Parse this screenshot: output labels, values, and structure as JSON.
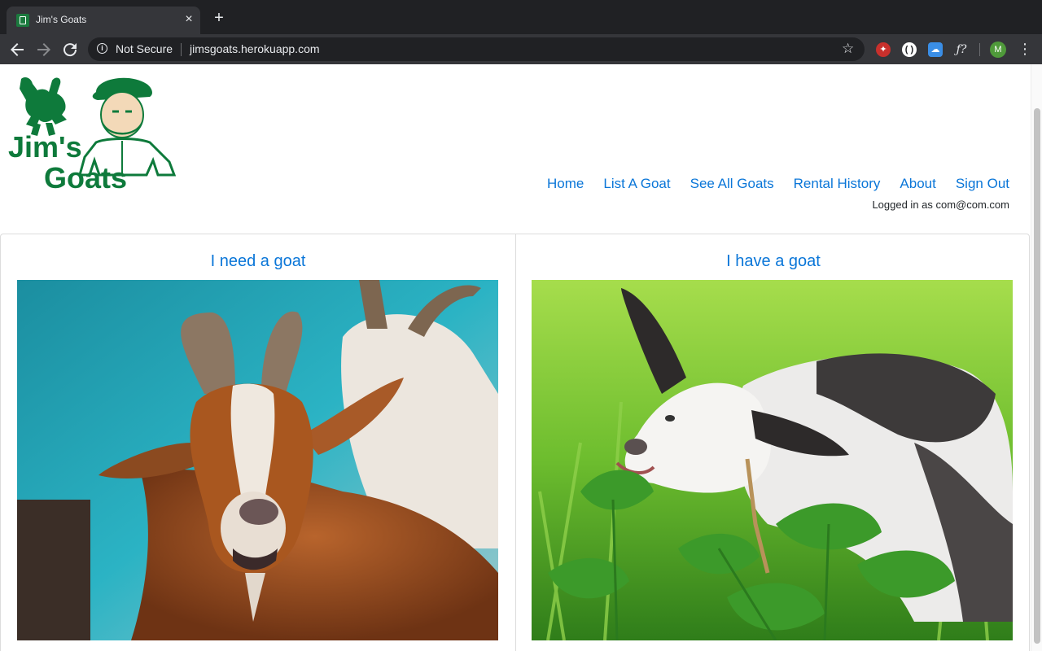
{
  "browser": {
    "tab_title": "Jim's Goats",
    "tab_close": "×",
    "new_tab": "+",
    "security_label": "Not Secure",
    "url": "jimsgoats.herokuapp.com",
    "profile_initial": "M",
    "icons": [
      "back-icon",
      "forward-icon",
      "reload-icon",
      "info-icon",
      "star-icon",
      "menu-icon"
    ]
  },
  "site": {
    "logo_line1": "Jim's",
    "logo_line2": "Goats",
    "brand_color": "#0e7a3b",
    "link_color": "#0a76d8"
  },
  "nav": {
    "home": "Home",
    "list_goat": "List A Goat",
    "see_all": "See All Goats",
    "rental_history": "Rental History",
    "about": "About",
    "sign_out": "Sign Out"
  },
  "user": {
    "logged_in_text": "Logged in as com@com.com"
  },
  "cards": [
    {
      "title": "I need a goat"
    },
    {
      "title": "I have a goat"
    }
  ]
}
